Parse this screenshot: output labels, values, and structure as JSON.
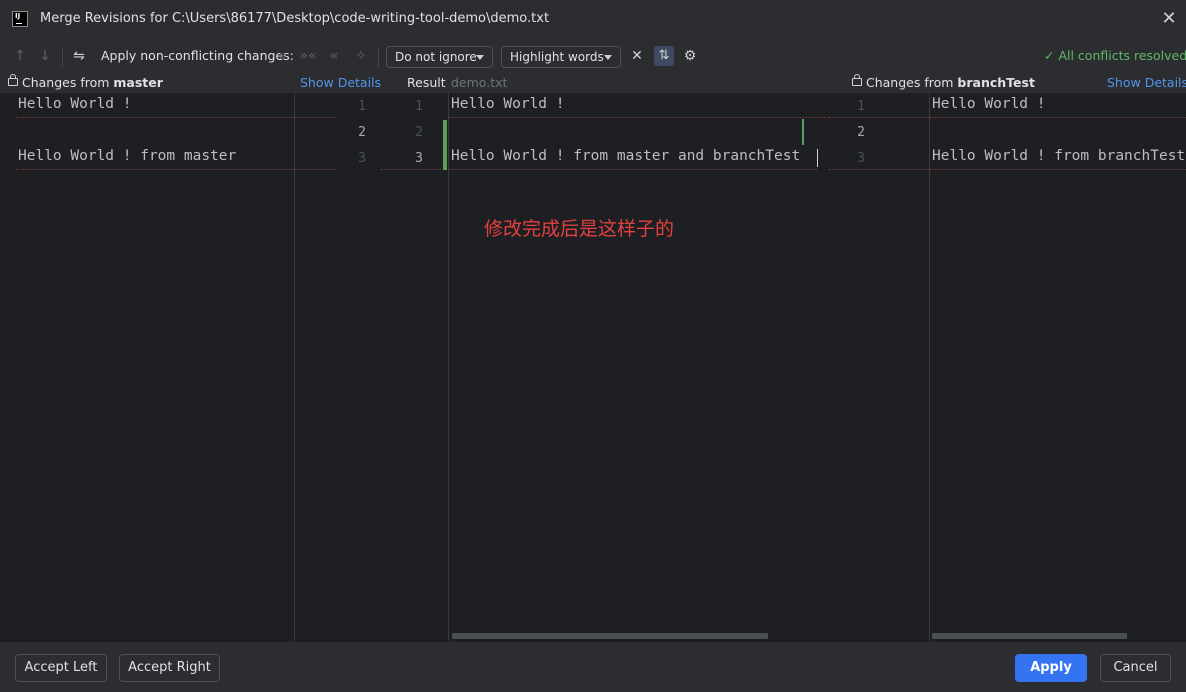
{
  "window": {
    "title": "Merge Revisions for C:\\Users\\86177\\Desktop\\code-writing-tool-demo\\demo.txt",
    "app_icon_text": "IJ"
  },
  "toolbar": {
    "apply_nc_label": "Apply non-conflicting changes:",
    "ignore_dropdown": "Do not ignore",
    "highlight_dropdown": "Highlight words",
    "status": "All conflicts resolved",
    "icons": [
      "arrow-up",
      "arrow-down",
      "resolve-icon",
      "apply-all",
      "apply-left",
      "apply-right",
      "magic-resolve",
      "collapse",
      "sync-scroll",
      "settings"
    ]
  },
  "headers": {
    "left_prefix": "Changes from ",
    "left_branch": "master",
    "left_details": "Show Details",
    "result_label": "Result",
    "result_file": "demo.txt",
    "right_prefix": "Changes from ",
    "right_branch": "branchTest",
    "right_details": "Show Details"
  },
  "left_pane": {
    "lines": [
      "Hello World !",
      "",
      "Hello World !  from master"
    ]
  },
  "left_gutter": {
    "numbers": [
      "1",
      "2",
      "3"
    ]
  },
  "result_gutter": {
    "numbers": [
      "1",
      "2",
      "3"
    ]
  },
  "result_pane": {
    "lines": [
      "Hello World !",
      "",
      "Hello World !  from master and branchTest"
    ]
  },
  "right_gutter": {
    "numbers": [
      "1",
      "2",
      "3"
    ]
  },
  "right_pane": {
    "lines": [
      "Hello World !",
      "",
      "Hello World ! from branchTest"
    ]
  },
  "annotation": "修改完成后是这样子的",
  "footer": {
    "accept_left": "Accept Left",
    "accept_right": "Accept Right",
    "apply": "Apply",
    "cancel": "Cancel"
  },
  "colors": {
    "accent": "#3574f0",
    "success": "#5fb865",
    "annotation": "#e34040",
    "change_marker": "#5a9e59",
    "link": "#5594ec"
  }
}
